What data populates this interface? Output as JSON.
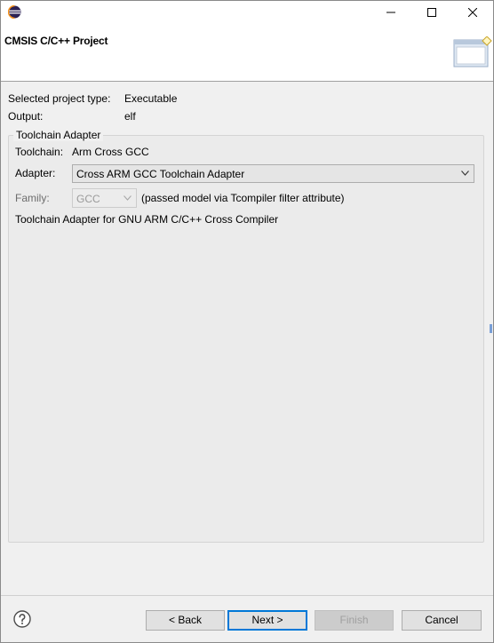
{
  "window": {
    "title": "CMSIS C/C++ Project",
    "icons": {
      "app": "eclipse-icon",
      "minimize": "minimize-icon",
      "maximize": "maximize-icon",
      "close": "close-icon",
      "banner": "wizard-banner-icon"
    }
  },
  "summary": {
    "project_type_label": "Selected project type:",
    "project_type_value": "Executable",
    "output_label": "Output:",
    "output_value": "elf"
  },
  "toolchain_group": {
    "title": "Toolchain Adapter",
    "toolchain_label": "Toolchain:",
    "toolchain_value": "Arm Cross GCC",
    "adapter_label": "Adapter:",
    "adapter_selected": "Cross ARM GCC Toolchain Adapter",
    "family_label": "Family:",
    "family_selected": "GCC",
    "family_note": "(passed model via Tcompiler filter attribute)",
    "description": "Toolchain Adapter for GNU ARM C/C++ Cross Compiler"
  },
  "buttons": {
    "back": "< Back",
    "next": "Next >",
    "finish": "Finish",
    "cancel": "Cancel",
    "help_icon": "help-icon"
  },
  "colors": {
    "accent": "#0078d7",
    "window_bg": "#f0f0f0"
  }
}
